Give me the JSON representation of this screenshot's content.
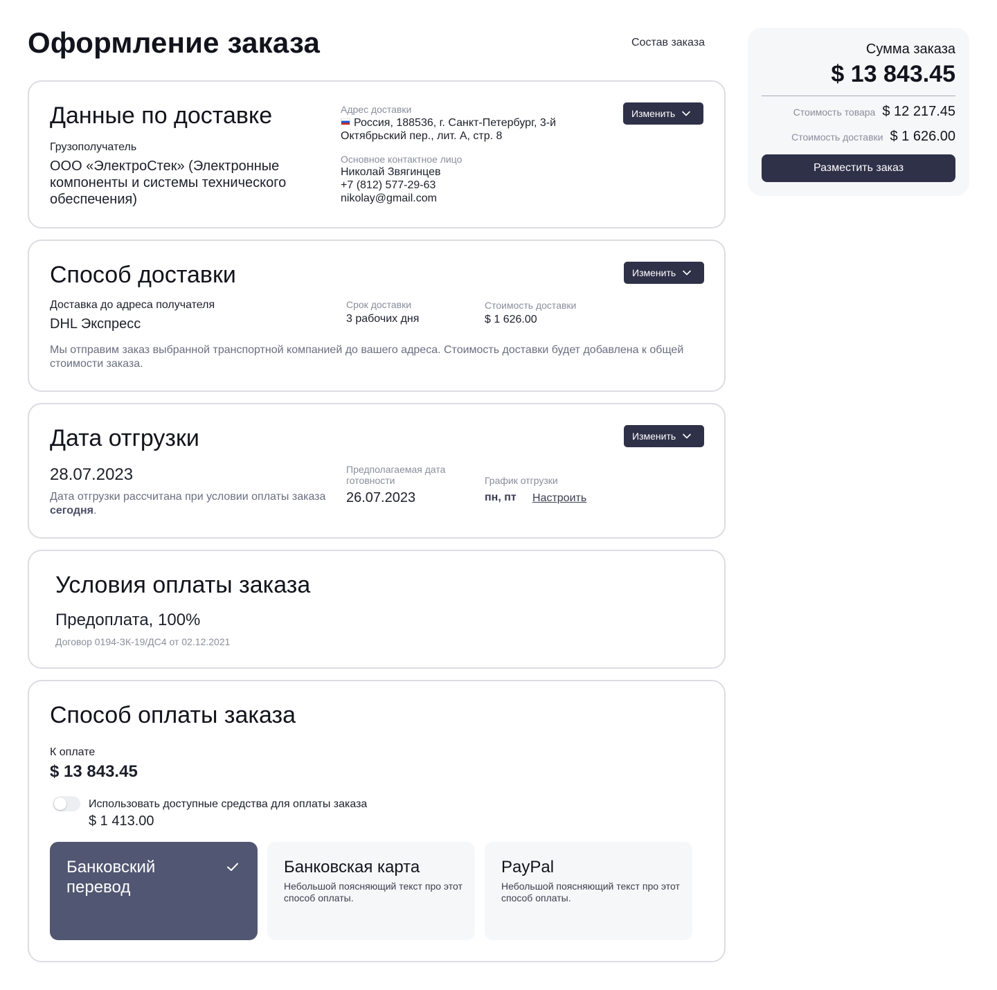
{
  "header": {
    "title": "Оформление заказа",
    "composition_link": "Состав заказа"
  },
  "delivery_data": {
    "title": "Данные по доставке",
    "consignee_label": "Грузополучатель",
    "consignee_value": "ООО «ЭлектроСтек» (Электронные компоненты и системы технического обеспечения)",
    "address_label": "Адрес доставки",
    "address_value": "Россия, 188536, г. Санкт-Петербург, 3-й Октябрьский пер., лит. А, стр. 8",
    "contact_label": "Основное контактное лицо",
    "contact_name": "Николай Звягинцев",
    "contact_phone": "+7 (812) 577-29-63",
    "contact_email": "nikolay@gmail.com",
    "edit_label": "Изменить"
  },
  "delivery_method": {
    "title": "Способ доставки",
    "type_label": "Доставка до адреса получателя",
    "type_value": "DHL Экспресс",
    "term_label": "Срок доставки",
    "term_value": "3 рабочих дня",
    "cost_label": "Стоимость доставки",
    "cost_value": "$ 1 626.00",
    "note": "Мы отправим заказ выбранной транспортной компанией до вашего адреса. Стоимость доставки будет добавлена к общей стоимости заказа.",
    "edit_label": "Изменить"
  },
  "shipment_date": {
    "title": "Дата отгрузки",
    "date_value": "28.07.2023",
    "note_prefix": "Дата отгрузки рассчитана при условии оплаты заказа ",
    "note_bold": "сегодня",
    "note_suffix": ".",
    "ready_label": "Предполагаемая дата готовности",
    "ready_value": "26.07.2023",
    "schedule_label": "График отгрузки",
    "schedule_value": "пн, пт",
    "schedule_link": "Настроить",
    "edit_label": "Изменить"
  },
  "payment_terms": {
    "title": "Условия оплаты заказа",
    "value": "Предоплата, 100%",
    "contract": "Договор 0194-ЗК-19/ДС4 от 02.12.2021"
  },
  "payment_method": {
    "title": "Способ оплаты заказа",
    "to_pay_label": "К оплате",
    "to_pay_value": "$ 13 843.45",
    "use_funds_label": "Использовать доступные средства для оплаты заказа",
    "use_funds_amount": "$ 1 413.00",
    "use_funds_enabled": false,
    "options": [
      {
        "title": "Банковский перевод",
        "desc": "",
        "selected": true
      },
      {
        "title": "Банковская карта",
        "desc": "Небольшой поясняющий текст про этот способ оплаты.",
        "selected": false
      },
      {
        "title": "PayPal",
        "desc": "Небольшой поясняющий текст про этот способ оплаты.",
        "selected": false
      }
    ]
  },
  "summary": {
    "title": "Сумма заказа",
    "total": "$ 13 843.45",
    "goods_label": "Стоимость товара",
    "goods_value": "$ 12 217.45",
    "delivery_label": "Стоимость доставки",
    "delivery_value": "$ 1 626.00",
    "place_order_label": "Разместить заказ"
  },
  "colors": {
    "primary_dark": "#2e3148",
    "selected_option": "#515772",
    "card_border": "#dcdde2",
    "muted_text": "#8a8d9c",
    "summary_bg": "#f6f7f9"
  },
  "icons": {
    "edit_chevron": "chevron-down-icon",
    "selected_check": "check-icon",
    "address_flag": "russia-flag-icon"
  }
}
